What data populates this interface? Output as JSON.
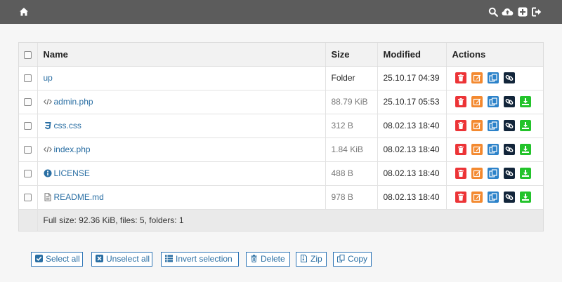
{
  "table": {
    "headers": {
      "name": "Name",
      "size": "Size",
      "modified": "Modified",
      "actions": "Actions"
    },
    "rows": [
      {
        "name": "up",
        "size": "Folder",
        "modified": "25.10.17 04:39",
        "icon": "arrow-up-folder-icon"
      },
      {
        "name": "admin.php",
        "size": "88.79 KiB",
        "modified": "25.10.17 05:53",
        "icon": "code-icon"
      },
      {
        "name": "css.css",
        "size": "312 B",
        "modified": "08.02.13 18:40",
        "icon": "css3-icon"
      },
      {
        "name": "index.php",
        "size": "1.84 KiB",
        "modified": "08.02.13 18:40",
        "icon": "code-icon"
      },
      {
        "name": "LICENSE",
        "size": "488 B",
        "modified": "08.02.13 18:40",
        "icon": "info-circle-icon"
      },
      {
        "name": "README.md",
        "size": "978 B",
        "modified": "08.02.13 18:40",
        "icon": "file-text-icon"
      }
    ],
    "footer": "Full size: 92.36 KiB, files: 5, folders: 1"
  },
  "buttons": {
    "select_all": "Select all",
    "unselect_all": "Unselect all",
    "invert_selection": "Invert selection",
    "delete": "Delete",
    "zip": "Zip",
    "copy": "Copy"
  },
  "colors": {
    "topbar": "#5c5c5c",
    "link": "#296ea3",
    "delete": "#ec3437",
    "rename": "#f3892f",
    "copy": "#2c82c9",
    "direct_link": "#12253a",
    "download": "#23c32b"
  }
}
